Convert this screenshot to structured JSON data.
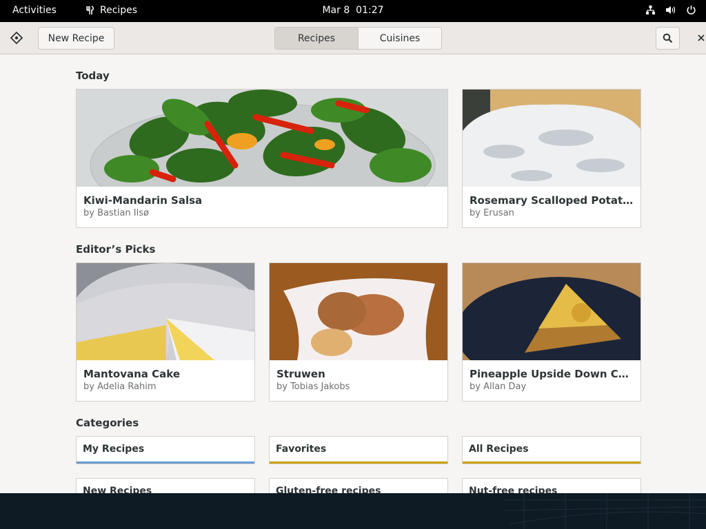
{
  "topbar": {
    "activities": "Activities",
    "app_name": "Recipes",
    "date": "Mar 8",
    "time": "01:27"
  },
  "header": {
    "new_recipe": "New Recipe",
    "tabs": [
      "Recipes",
      "Cuisines"
    ],
    "active_tab": "Recipes"
  },
  "today": {
    "title": "Today",
    "cards": [
      {
        "title": "Kiwi-Mandarin Salsa",
        "author": "by Bastian Ilsø"
      },
      {
        "title": "Rosemary Scalloped Potatoes",
        "author": "by Erusan"
      }
    ]
  },
  "picks": {
    "title": "Editor’s Picks",
    "cards": [
      {
        "title": "Mantovana Cake",
        "author": "by Adelia Rahim"
      },
      {
        "title": "Struwen",
        "author": "by Tobias Jakobs"
      },
      {
        "title": "Pineapple Upside Down Cake …",
        "author": "by Allan Day"
      }
    ]
  },
  "categories": {
    "title": "Categories",
    "items": [
      "My Recipes",
      "Favorites",
      "All Recipes",
      "New Recipes",
      "Gluten-free recipes",
      "Nut-free recipes"
    ],
    "colors": [
      "#6a9bd1",
      "#c8a000",
      "#c8a000"
    ]
  }
}
